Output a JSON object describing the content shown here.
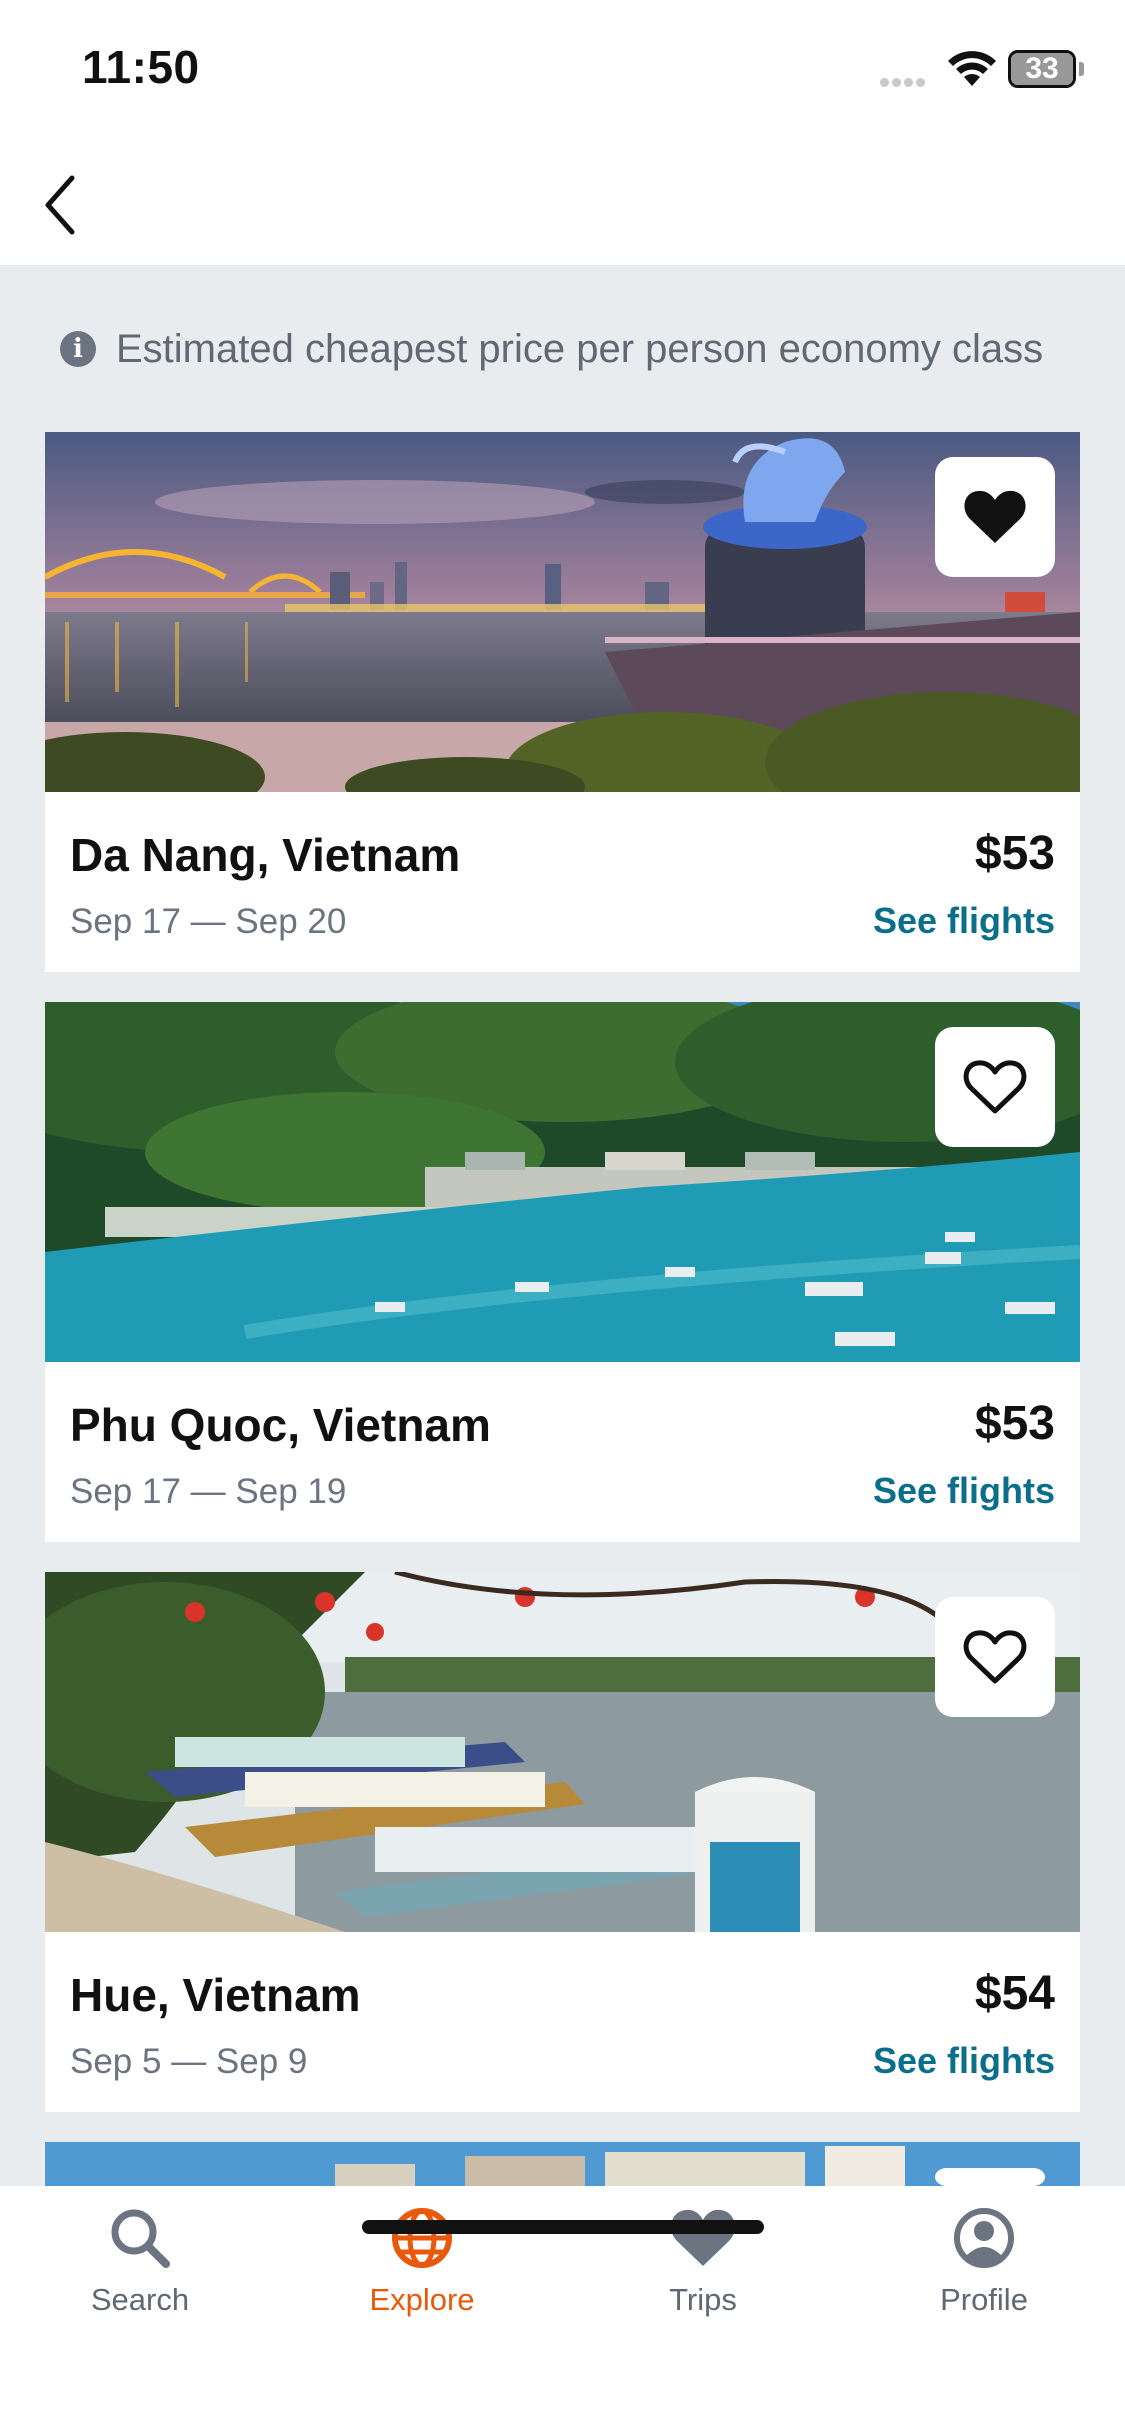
{
  "status_bar": {
    "time": "11:50",
    "battery": "33"
  },
  "info": {
    "text": "Estimated cheapest price per person economy class"
  },
  "destinations": [
    {
      "name": "Da Nang, Vietnam",
      "dates": "Sep 17 — Sep 20",
      "price": "$53",
      "action": "See flights",
      "favorited": true
    },
    {
      "name": "Phu Quoc, Vietnam",
      "dates": "Sep 17 — Sep 19",
      "price": "$53",
      "action": "See flights",
      "favorited": false
    },
    {
      "name": "Hue, Vietnam",
      "dates": "Sep 5 — Sep 9",
      "price": "$54",
      "action": "See flights",
      "favorited": false
    }
  ],
  "tabs": [
    {
      "label": "Search",
      "icon": "search-icon"
    },
    {
      "label": "Explore",
      "icon": "globe-icon",
      "active": true
    },
    {
      "label": "Trips",
      "icon": "heart-icon"
    },
    {
      "label": "Profile",
      "icon": "profile-icon"
    }
  ],
  "colors": {
    "accent": "#e8590c",
    "link": "#0b6f8c",
    "background": "#e9ecef"
  }
}
